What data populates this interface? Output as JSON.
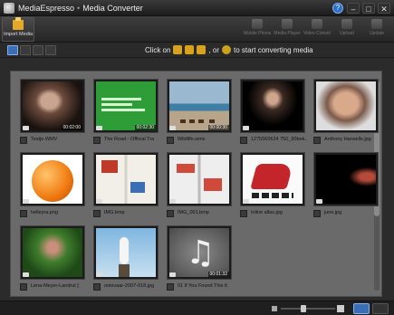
{
  "window": {
    "app_name": "MediaEspresso",
    "separator": "•",
    "title": "Media Converter",
    "minimize": "–",
    "maximize": "□",
    "close": "✕",
    "help": "?"
  },
  "toolbar": {
    "import_label": "Import Media",
    "devices": [
      {
        "label": "Mobile Phone"
      },
      {
        "label": "Media Player"
      },
      {
        "label": "Video Console"
      },
      {
        "label": "Upload"
      },
      {
        "label": "Update"
      }
    ]
  },
  "subbar": {
    "hint_prefix": "Click on",
    "hint_or": ", or",
    "hint_suffix": "to start converting media"
  },
  "media": [
    {
      "caption": "Testje.WMV",
      "duration": "00:02:00"
    },
    {
      "caption": "The Road - Official Tra",
      "duration": "00:02:30"
    },
    {
      "caption": "Wildlife.wmv",
      "duration": "00:00:30"
    },
    {
      "caption": "1275560624 750_90bek..",
      "duration": ""
    },
    {
      "caption": "Anthony Harwells.jpg",
      "duration": ""
    },
    {
      "caption": "helleyra.png",
      "duration": ""
    },
    {
      "caption": "IMG.bmp",
      "duration": ""
    },
    {
      "caption": "IMG_001.bmp",
      "duration": ""
    },
    {
      "caption": "Inline allas.jpg",
      "duration": ""
    },
    {
      "caption": "june.jpg",
      "duration": ""
    },
    {
      "caption": "Lena-Meyer-Landrut [",
      "duration": ""
    },
    {
      "caption": "ooievaar-2007-018.jpg",
      "duration": ""
    },
    {
      "caption": "01 If You Found This It",
      "duration": "00:01:32"
    }
  ]
}
